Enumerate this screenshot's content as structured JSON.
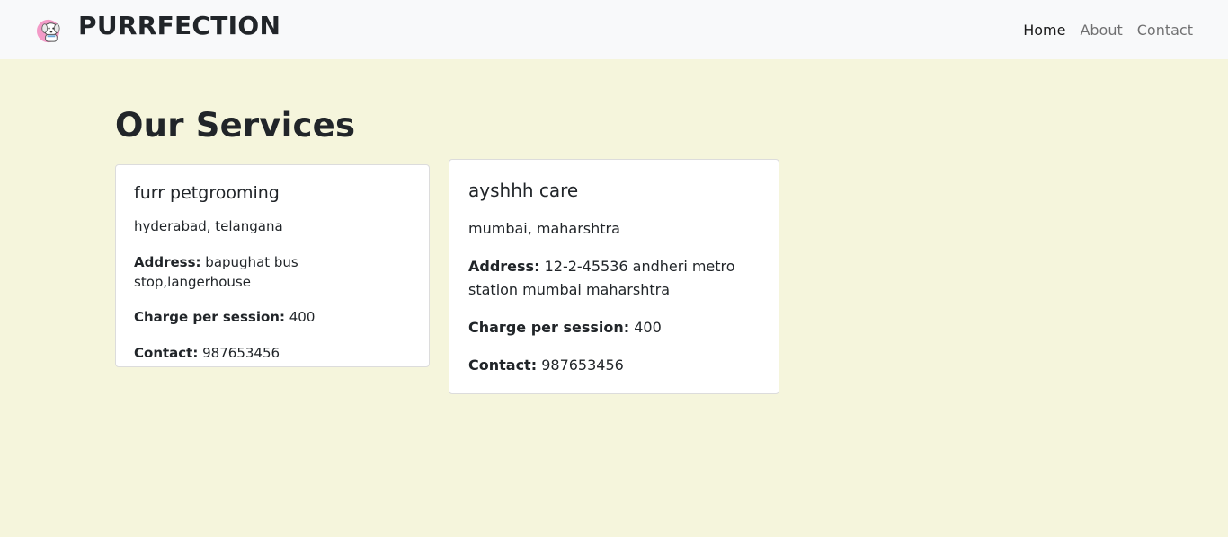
{
  "navbar": {
    "brand": "PURRFECTION",
    "logo_icon": "dog-logo-icon",
    "links": [
      "Home",
      "About",
      "Contact"
    ],
    "active": "Home"
  },
  "main": {
    "title": "Our Services",
    "cards": [
      {
        "name": "furr petgrooming",
        "location": "hyderabad, telangana",
        "address_label": "Address:",
        "address": "bapughat bus stop,langerhouse",
        "charge_label": "Charge per session:",
        "charge": "400",
        "contact_label": "Contact:",
        "contact": "987653456"
      },
      {
        "name": "ayshhh care",
        "location": "mumbai, maharshtra",
        "address_label": "Address:",
        "address": "12-2-45536 andheri metro station mumbai maharshtra",
        "charge_label": "Charge per session:",
        "charge": "400",
        "contact_label": "Contact:",
        "contact": "987653456"
      }
    ]
  },
  "colors": {
    "page_background": "#f5f5dc",
    "navbar_background": "#f8f9fa",
    "card_background": "#ffffff"
  }
}
